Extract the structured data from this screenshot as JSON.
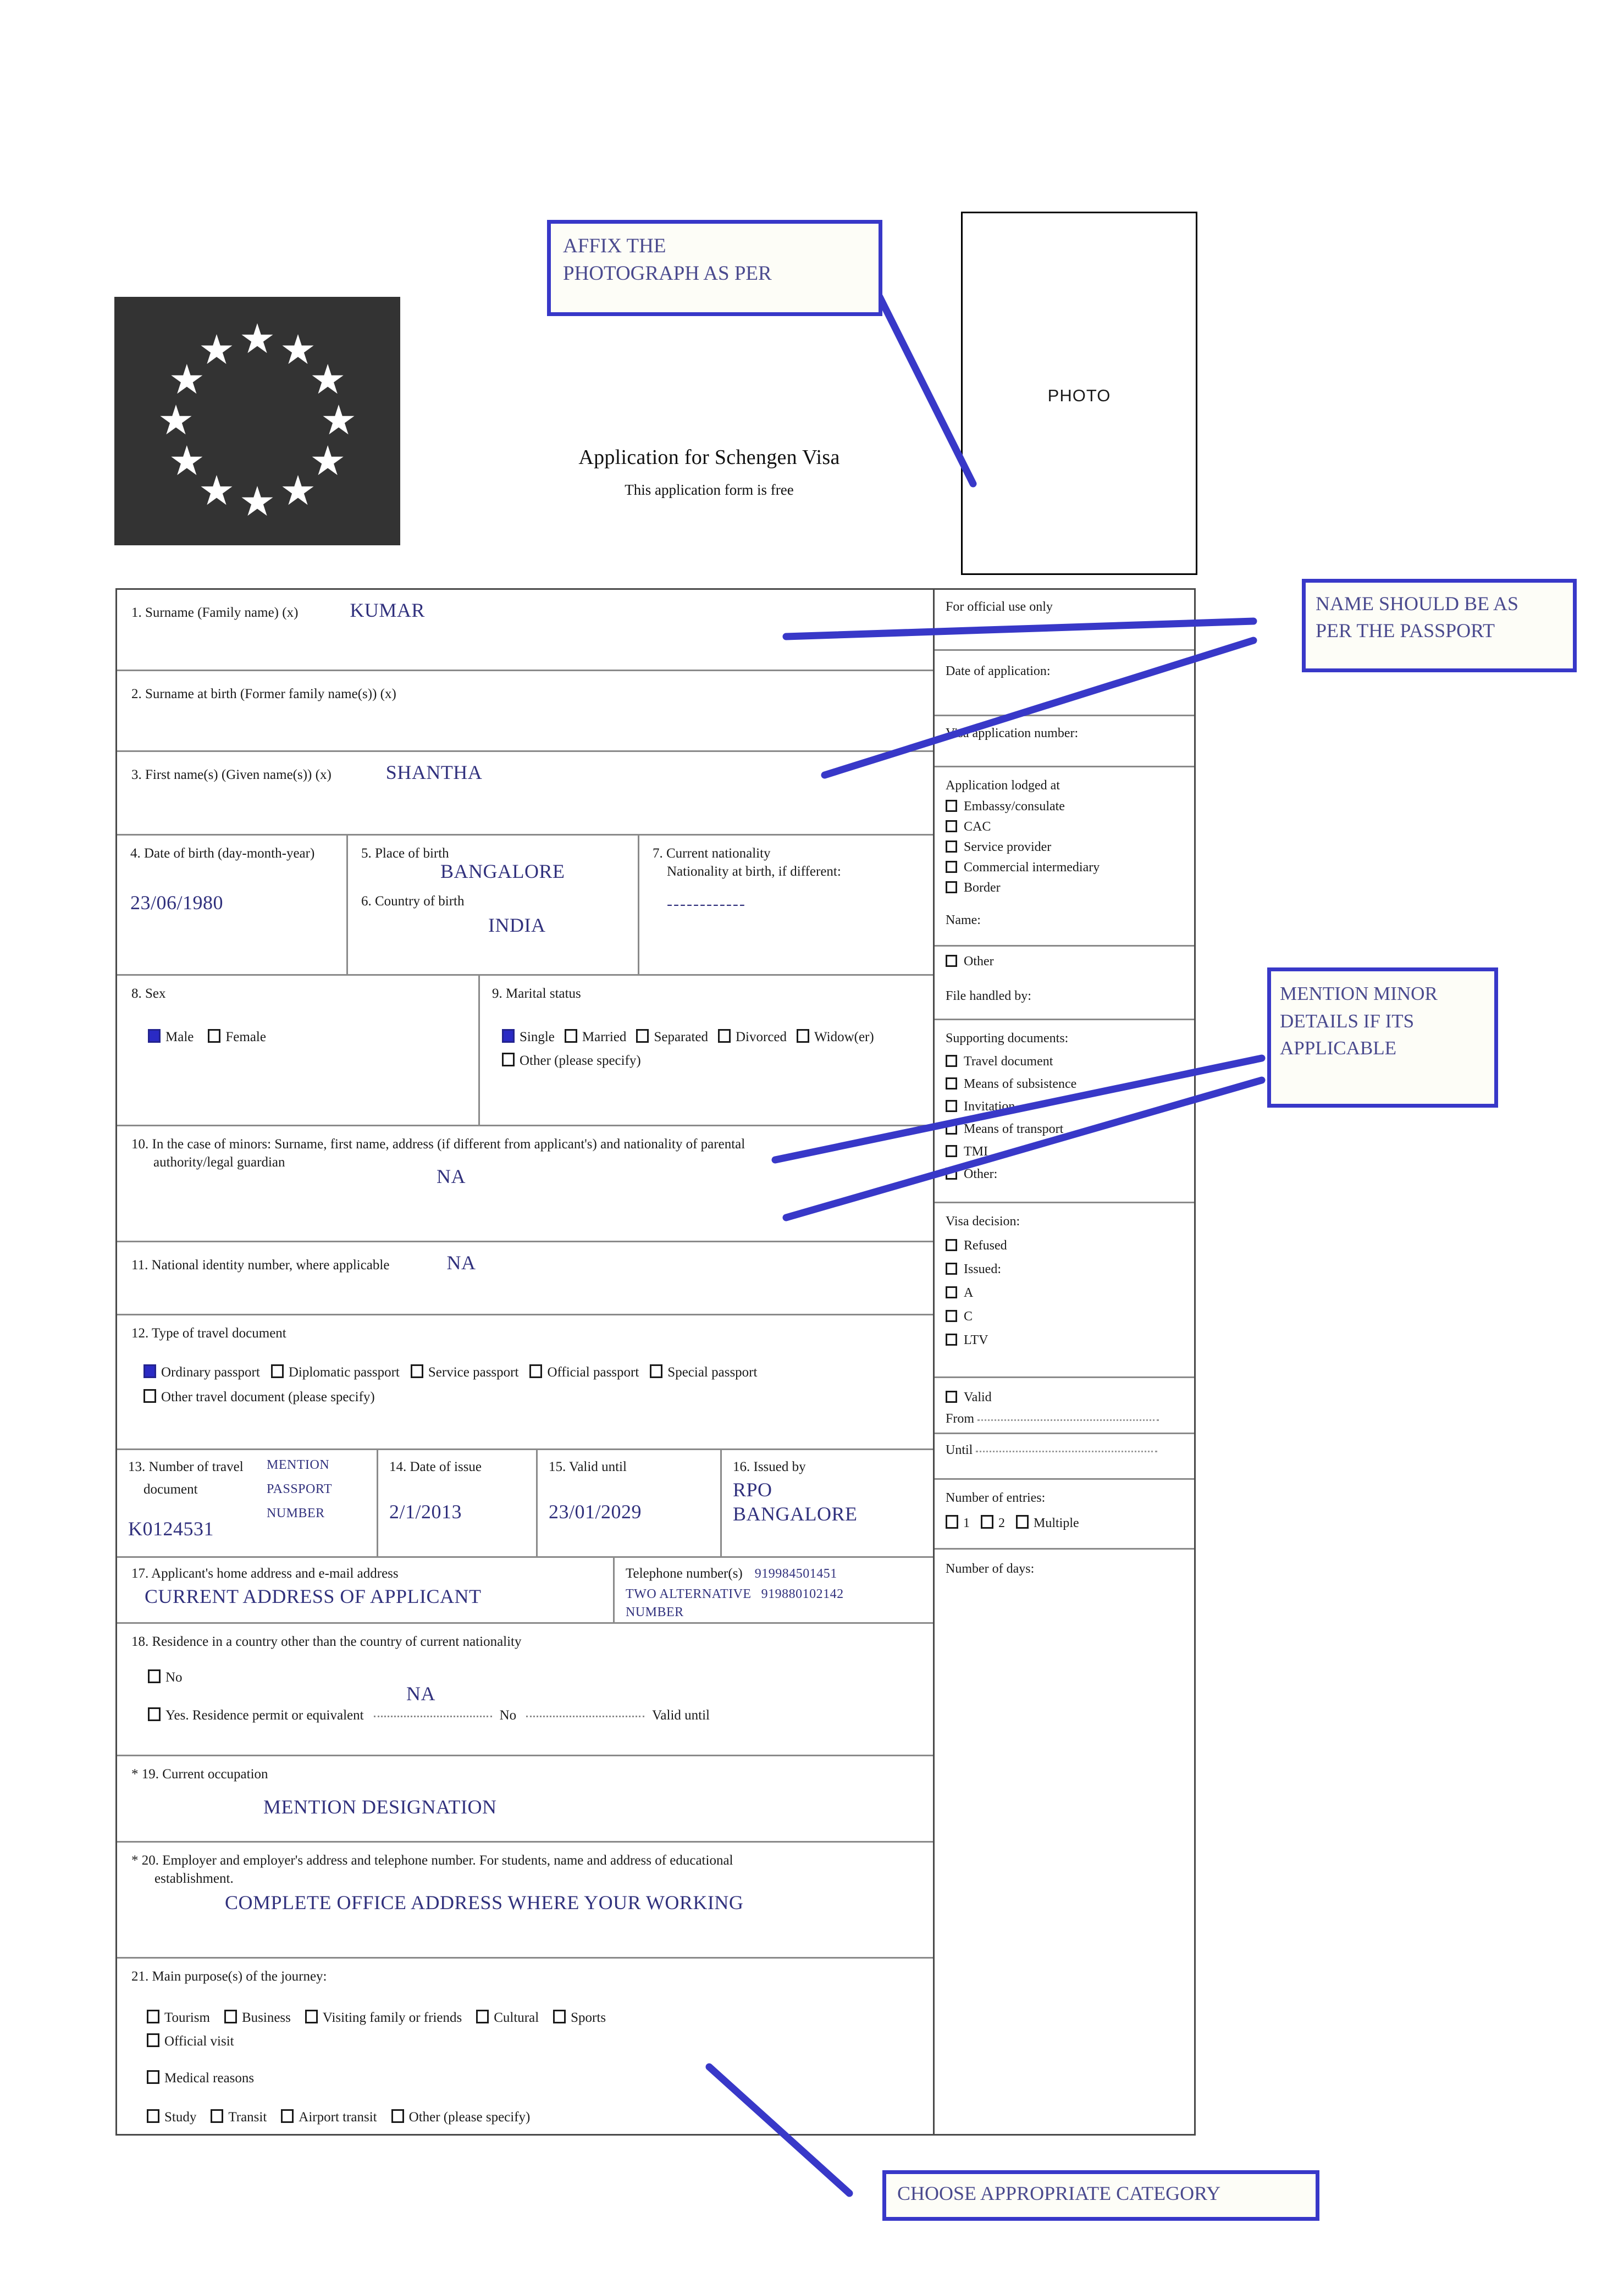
{
  "header": {
    "title": "Application for Schengen Visa",
    "subtitle": "This application form is free",
    "photo_placeholder": "PHOTO",
    "flag_icon": "eu-flag-icon"
  },
  "annotations": [
    {
      "id": "affix-photo",
      "text_lines": [
        "AFFIX THE",
        "PHOTOGRAPH AS PER"
      ]
    },
    {
      "id": "name-passport",
      "text_lines": [
        "NAME SHOULD BE AS",
        "PER THE PASSPORT"
      ]
    },
    {
      "id": "minor-details",
      "text_lines": [
        "MENTION MINOR",
        "DETAILS IF ITS",
        "APPLICABLE"
      ]
    },
    {
      "id": "choose-category",
      "text_lines": [
        "CHOOSE APPROPRIATE CATEGORY"
      ]
    }
  ],
  "fields": {
    "f1": {
      "label": "1. Surname (Family name) (x)",
      "value": "KUMAR"
    },
    "f2": {
      "label": "2. Surname at birth (Former family name(s)) (x)",
      "value": ""
    },
    "f3": {
      "label": "3. First name(s) (Given name(s)) (x)",
      "value": "SHANTHA"
    },
    "f4": {
      "label": "4. Date of birth (day-month-year)",
      "value": "23/06/1980"
    },
    "f5": {
      "label": "5. Place of birth",
      "value": "BANGALORE"
    },
    "f6": {
      "label": "6. Country of birth",
      "value": "INDIA"
    },
    "f7": {
      "label": "7. Current nationality",
      "label2": "Nationality at birth, if different:",
      "value": "------------"
    },
    "f8": {
      "label": "8. Sex",
      "options": [
        {
          "label": "Male",
          "checked": true
        },
        {
          "label": "Female",
          "checked": false
        }
      ]
    },
    "f9": {
      "label": "9. Marital status",
      "options": [
        {
          "label": "Single",
          "checked": true
        },
        {
          "label": "Married",
          "checked": false
        },
        {
          "label": "Separated",
          "checked": false
        },
        {
          "label": "Divorced",
          "checked": false
        },
        {
          "label": "Widow(er)",
          "checked": false
        },
        {
          "label": "Other (please specify)",
          "checked": false
        }
      ]
    },
    "f10": {
      "label": "10. In the case of minors: Surname, first name, address (if different from applicant's) and nationality of parental",
      "label2": "authority/legal guardian",
      "value": "NA"
    },
    "f11": {
      "label": "11. National identity number, where applicable",
      "value": "NA"
    },
    "f12": {
      "label": "12. Type of travel document",
      "options": [
        {
          "label": "Ordinary passport",
          "checked": true
        },
        {
          "label": "Diplomatic passport",
          "checked": false
        },
        {
          "label": "Service passport",
          "checked": false
        },
        {
          "label": "Official passport",
          "checked": false
        },
        {
          "label": "Special passport",
          "checked": false
        },
        {
          "label": "Other travel document (please specify)",
          "checked": false
        }
      ]
    },
    "f13": {
      "label": "13. Number of travel",
      "label2": "document",
      "hint_lines": [
        "MENTION",
        "PASSPORT",
        "NUMBER"
      ],
      "value": "K0124531"
    },
    "f14": {
      "label": "14. Date of issue",
      "value": "2/1/2013"
    },
    "f15": {
      "label": "15. Valid until",
      "value": "23/01/2029"
    },
    "f16": {
      "label": "16. Issued by",
      "value_lines": [
        "RPO",
        "BANGALORE"
      ]
    },
    "f17": {
      "label": "17. Applicant's home address and e-mail address",
      "value": "CURRENT ADDRESS OF APPLICANT",
      "phone_label": "Telephone number(s)",
      "phone1": "919984501451",
      "phone_hint_lines": [
        "TWO ALTERNATIVE",
        "NUMBER"
      ],
      "phone2": "919880102142"
    },
    "f18": {
      "label": "18. Residence in a country other than the country of current nationality",
      "no_label": "No",
      "value": "NA",
      "yes_label": "Yes. Residence permit or equivalent",
      "yes_mid": "No",
      "yes_end": "Valid until"
    },
    "f19": {
      "label": "* 19. Current occupation",
      "value": "MENTION DESIGNATION"
    },
    "f20": {
      "label": "* 20. Employer and employer's address and telephone number. For students, name and address of educational",
      "label2": "establishment.",
      "value": "COMPLETE OFFICE ADDRESS WHERE YOUR WORKING"
    },
    "f21": {
      "label": "21. Main purpose(s) of the journey:",
      "row1": [
        {
          "label": "Tourism"
        },
        {
          "label": "Business"
        },
        {
          "label": "Visiting family or friends"
        },
        {
          "label": "Cultural"
        },
        {
          "label": "Sports"
        }
      ],
      "row2": [
        {
          "label": "Official visit"
        }
      ],
      "row3": [
        {
          "label": "Medical reasons"
        }
      ],
      "row4": [
        {
          "label": "Study"
        },
        {
          "label": "Transit"
        },
        {
          "label": "Airport transit"
        },
        {
          "label": "Other (please specify)"
        }
      ]
    }
  },
  "official": {
    "title": "For official use only",
    "date_of_application": "Date of application:",
    "visa_application_number": "Visa application number:",
    "lodged_at_label": "Application lodged at",
    "lodged_at": [
      "Embassy/consulate",
      "CAC",
      "Service provider",
      "Commercial intermediary",
      "Border"
    ],
    "name_label": "Name:",
    "other_label": "Other",
    "file_handled_by": "File handled by:",
    "supporting_documents_label": "Supporting documents:",
    "supporting_documents": [
      "Travel document",
      "Means of subsistence",
      "Invitation",
      "Means of transport",
      "TMI",
      "Other:"
    ],
    "visa_decision_label": "Visa decision:",
    "visa_decision": [
      "Refused",
      "Issued:",
      "A",
      "C",
      "LTV"
    ],
    "valid_label": "Valid",
    "from_label": "From",
    "until_label": "Until",
    "entries_label": "Number of entries:",
    "entries": [
      "1",
      "2",
      "Multiple"
    ],
    "days_label": "Number of days:"
  },
  "colors": {
    "annotation_blue": "#3838c8",
    "answer_ink": "#31317d",
    "checkbox_fill": "#2a2ac4",
    "flag_bg": "#333333"
  }
}
